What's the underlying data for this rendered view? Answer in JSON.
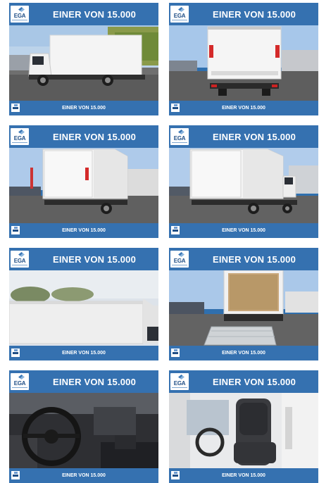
{
  "listing": {
    "brand_logo_text": "EGA",
    "tiles": [
      {
        "title": "EINER VON 15.000",
        "footer": "EINER VON 15.000",
        "photo": "truck-side-view-photo"
      },
      {
        "title": "EINER VON 15.000",
        "footer": "EINER VON 15.000",
        "photo": "truck-rear-view-photo"
      },
      {
        "title": "EINER VON 15.000",
        "footer": "EINER VON 15.000",
        "photo": "truck-rear-left-view-photo"
      },
      {
        "title": "EINER VON 15.000",
        "footer": "EINER VON 15.000",
        "photo": "truck-rear-left-view-photo-2"
      },
      {
        "title": "EINER VON 15.000",
        "footer": "EINER VON 15.000",
        "photo": "box-body-roof-view-photo"
      },
      {
        "title": "EINER VON 15.000",
        "footer": "EINER VON 15.000",
        "photo": "tail-lift-open-cargo-photo"
      },
      {
        "title": "EINER VON 15.000",
        "footer": "EINER VON 15.000",
        "photo": "cabin-steering-wheel-photo"
      },
      {
        "title": "EINER VON 15.000",
        "footer": "EINER VON 15.000",
        "photo": "cabin-driver-seat-photo"
      }
    ]
  },
  "colors": {
    "banner": "#3571b0",
    "logo_blue": "#1f4e86"
  }
}
